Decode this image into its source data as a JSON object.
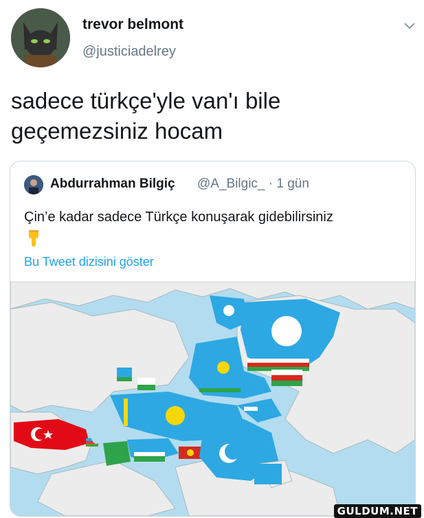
{
  "author": {
    "display_name": "trevor belmont",
    "handle": "@justiciadelrey",
    "avatar_icon": "cartoon-cat-avatar"
  },
  "tweet": {
    "lines": [
      "sadece türkçe'yle van'ı bile",
      "geçemezsiniz hocam"
    ]
  },
  "quoted_tweet": {
    "display_name": "Abdurrahman Bilgiç",
    "meta": "@A_Bilgic_ · 1 gün",
    "text": "Çin’e kadar sadece Türkçe konuşarak gidebilirsiniz",
    "emoji": "pointing-down-emoji",
    "thread_link": "Bu Tweet dizisini göster"
  },
  "colors": {
    "link": "#1da1f2",
    "ocean": "#b4dcf0",
    "land": "#ececec",
    "flag_blue": "#2ea8e2"
  },
  "watermark": "GULDUM.NET"
}
